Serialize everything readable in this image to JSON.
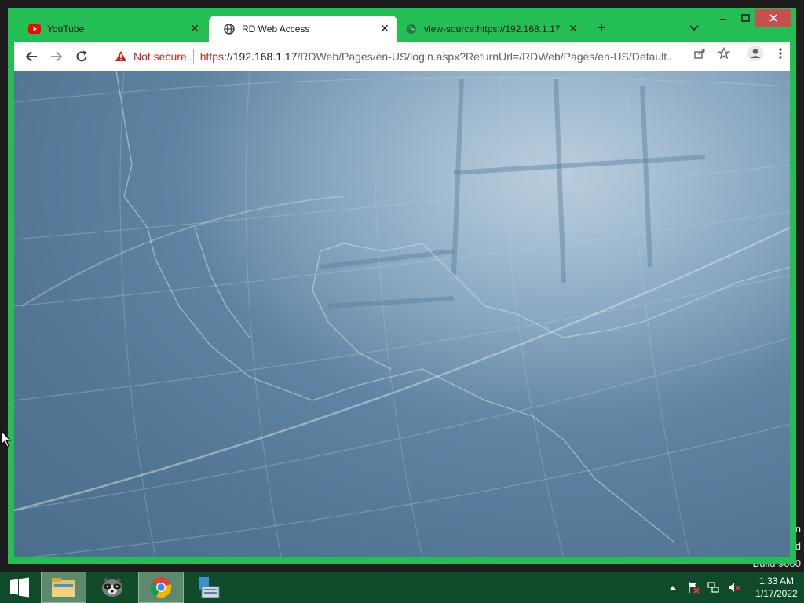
{
  "desktop": {
    "watermark_line1": "n",
    "watermark_line2": "d",
    "watermark_line3": "Build 9600"
  },
  "browser": {
    "tabs": [
      {
        "label": "YouTube",
        "icon": "youtube-icon",
        "active": false
      },
      {
        "label": "RD Web Access",
        "icon": "globe-icon",
        "active": true
      },
      {
        "label": "view-source:https://192.168.1.17",
        "icon": "globe-icon",
        "active": false
      }
    ],
    "new_tab_label": "+",
    "close_glyph": "✕",
    "toolbar": {
      "security_label": "Not secure",
      "url_scheme": "https",
      "url_host": "://192.168.1.17",
      "url_path": "/RDWeb/Pages/en-US/login.aspx?ReturnUrl=/RDWeb/Pages/en-US/Default.as..."
    },
    "colors": {
      "frame": "#23bf55",
      "close_button": "#c94f4f",
      "not_secure": "#c5221f"
    }
  },
  "taskbar": {
    "clock_time": "1:33 AM",
    "clock_date": "1/17/2022",
    "items": [
      "windows-start",
      "file-explorer",
      "raccoon-app",
      "chrome",
      "server-manager"
    ]
  }
}
